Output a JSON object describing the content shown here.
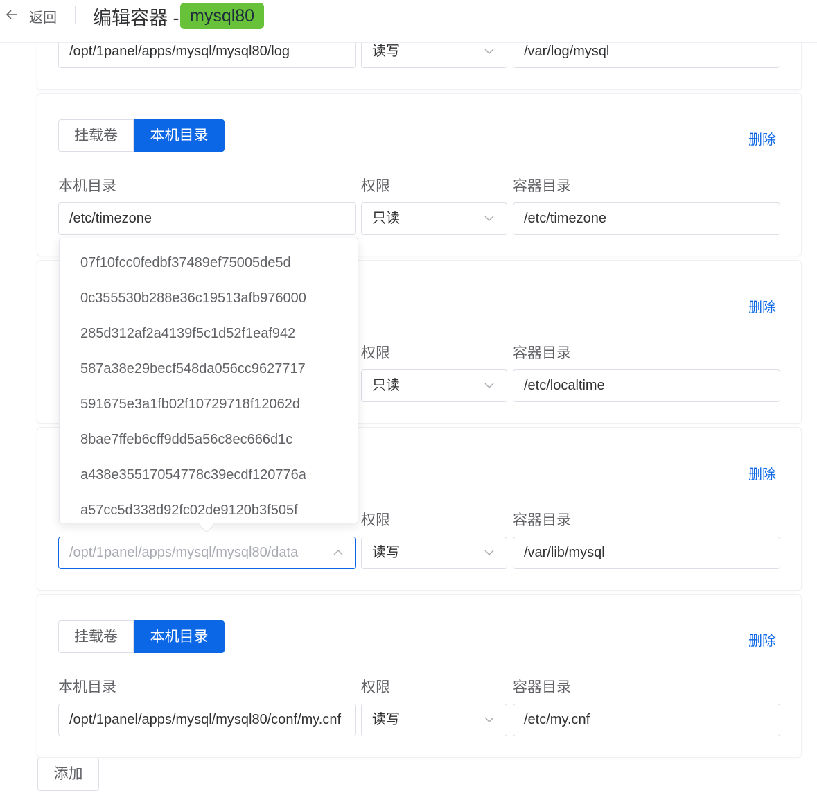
{
  "header": {
    "back_label": "返回",
    "title": "编辑容器 -",
    "container_name": "mysql80"
  },
  "labels": {
    "host_dir": "本机目录",
    "permission": "权限",
    "container_dir": "容器目录"
  },
  "mount_type": {
    "volume": "挂载卷",
    "host": "本机目录"
  },
  "delete_label": "删除",
  "mounts": [
    {
      "host_dir": "/opt/1panel/apps/mysql/mysql80/log",
      "permission": "读写",
      "container_dir": "/var/log/mysql"
    },
    {
      "host_dir": "/etc/timezone",
      "permission": "只读",
      "container_dir": "/etc/timezone"
    },
    {
      "host_dir": "",
      "permission": "只读",
      "container_dir": "/etc/localtime"
    },
    {
      "host_dir_placeholder": "/opt/1panel/apps/mysql/mysql80/data",
      "permission": "读写",
      "container_dir": "/var/lib/mysql"
    },
    {
      "host_dir": "/opt/1panel/apps/mysql/mysql80/conf/my.cnf",
      "permission": "读写",
      "container_dir": "/etc/my.cnf"
    }
  ],
  "dropdown": {
    "options": [
      "07f10fcc0fedbf37489ef75005de5d",
      "0c355530b288e36c19513afb976000",
      "285d312af2a4139f5c1d52f1eaf942",
      "587a38e29becf548da056cc9627717",
      "591675e3a1fb02f10729718f12062d",
      "8bae7ffeb6cff9dd5a56c8ec666d1c",
      "a438e35517054778c39ecdf120776a",
      "a57cc5d338d92fc02de9120b3f505f"
    ]
  },
  "add_label": "添加",
  "colors": {
    "primary": "#0c67e6",
    "tag_green": "#67c23a",
    "border": "#dcdfe6"
  }
}
